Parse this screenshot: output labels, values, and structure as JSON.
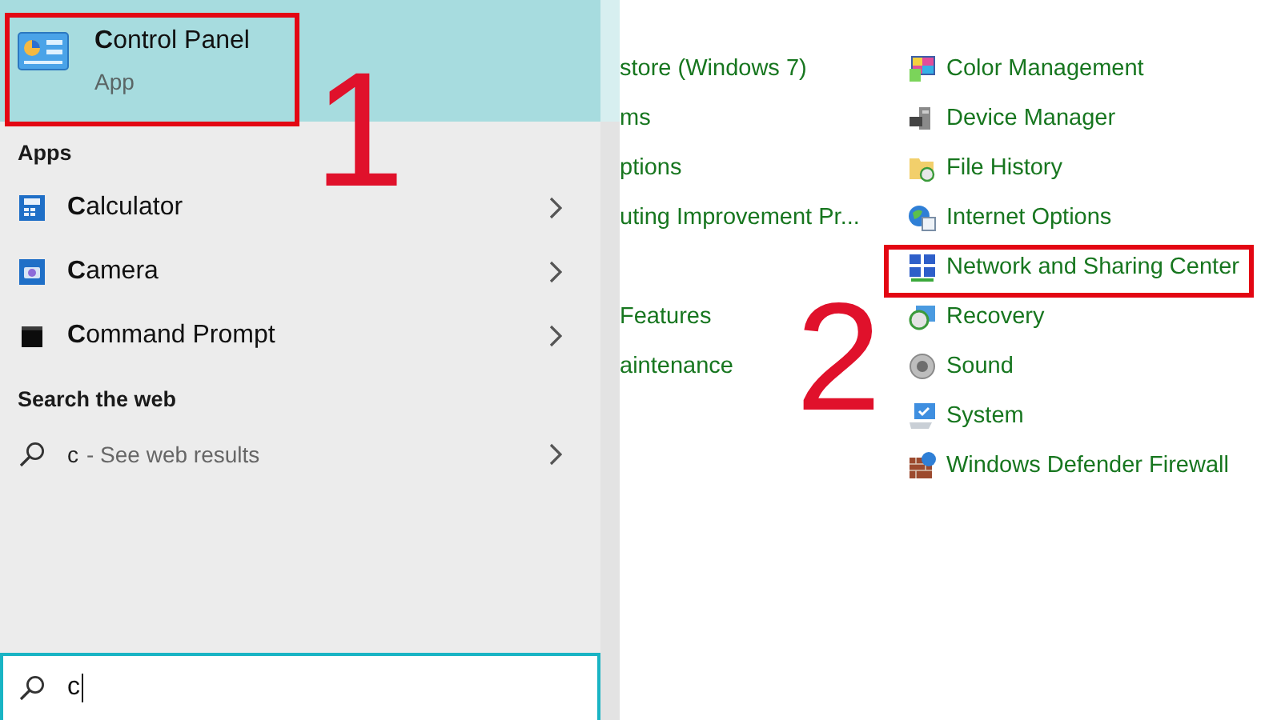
{
  "start_menu": {
    "best_match": {
      "title": "**C**ontrol Panel",
      "subtitle": "App",
      "selected": true,
      "callout": "1"
    },
    "apps_heading": "Apps",
    "apps": [
      {
        "label": "**C**alculator"
      },
      {
        "label": "**C**amera"
      },
      {
        "label": "**C**ommand Prompt"
      }
    ],
    "web_heading": "Search the web",
    "web_result": {
      "query": "c",
      "suffix": "- See web results"
    }
  },
  "search_box": {
    "value": "c"
  },
  "control_panel": {
    "column_1": [
      {
        "items": [
          {
            "label": "store (Windows 7)"
          },
          {
            "label": "ms"
          },
          {
            "label": "ptions"
          },
          {
            "label": "uting Improvement Pr..."
          }
        ]
      },
      {
        "items": [
          {
            "label": "Features"
          },
          {
            "label": "aintenance"
          }
        ]
      }
    ],
    "column_2": [
      {
        "label": "Color Management"
      },
      {
        "label": "Device Manager"
      },
      {
        "label": "File History"
      },
      {
        "label": "Internet Options"
      },
      {
        "label": "Network and Sharing Center",
        "callout": "2"
      },
      {
        "label": "Recovery"
      },
      {
        "label": "Sound"
      },
      {
        "label": "System"
      },
      {
        "label": "Windows Defender Firewall"
      }
    ]
  }
}
